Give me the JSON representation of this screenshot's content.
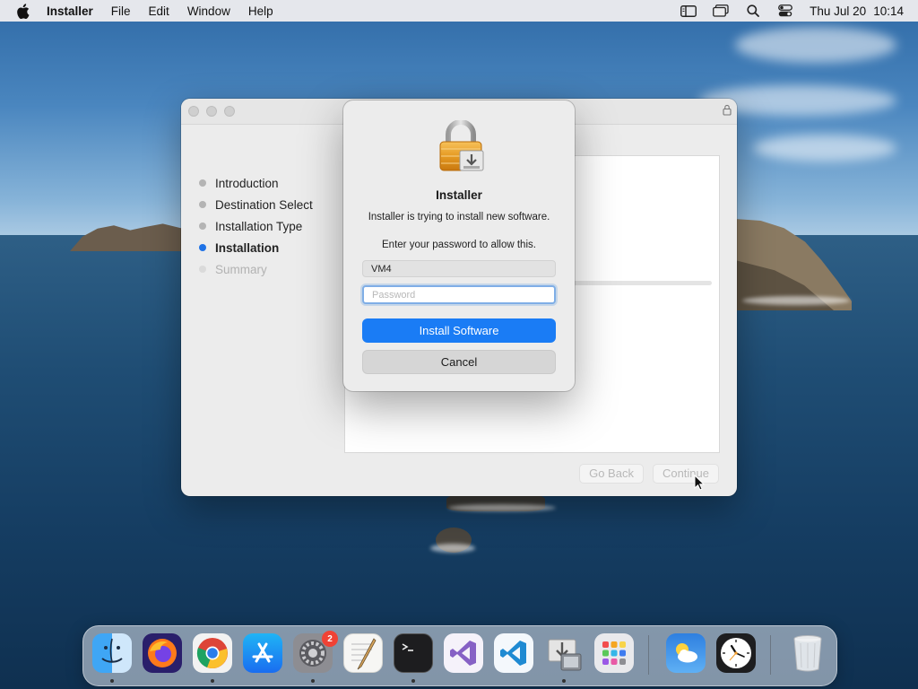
{
  "menubar": {
    "app_name": "Installer",
    "menus": [
      "File",
      "Edit",
      "Window",
      "Help"
    ],
    "date": "Thu Jul 20",
    "time": "10:14"
  },
  "installer": {
    "steps": [
      {
        "label": "Introduction",
        "state": "done"
      },
      {
        "label": "Destination Select",
        "state": "done"
      },
      {
        "label": "Installation Type",
        "state": "done"
      },
      {
        "label": "Installation",
        "state": "active"
      },
      {
        "label": "Summary",
        "state": "disabled"
      }
    ],
    "go_back_label": "Go Back",
    "continue_label": "Continue"
  },
  "dialog": {
    "title": "Installer",
    "message": "Installer is trying to install new software.",
    "prompt": "Enter your password to allow this.",
    "username": "VM4",
    "password_placeholder": "Password",
    "install_button": "Install Software",
    "cancel_button": "Cancel"
  },
  "dock": {
    "apps": [
      "finder",
      "firefox",
      "chrome",
      "app-store",
      "system-preferences",
      "textedit",
      "terminal",
      "visual-studio",
      "vscode",
      "installer",
      "launchpad"
    ],
    "others": [
      "weather",
      "clock",
      "trash"
    ],
    "settings_badge": "2"
  },
  "colors": {
    "accent": "#1a7cf5",
    "active_step_dot": "#1f72e6",
    "badge": "#f04235"
  }
}
